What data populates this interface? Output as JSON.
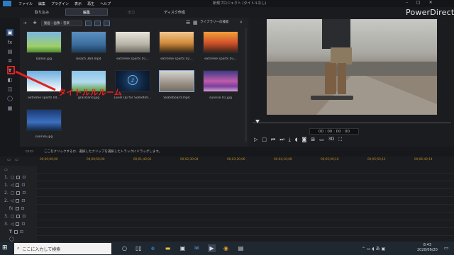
{
  "menu": [
    "ファイル",
    "編集",
    "プラグイン",
    "表示",
    "再生",
    "ヘルプ"
  ],
  "window_title": "新規プロジェクト (タイトルなし)",
  "modes": {
    "import": "取り込み",
    "edit": "編集",
    "produce": "出力",
    "disc": "ディスク作成"
  },
  "brand": "PowerDirector",
  "library": {
    "filter": "動画・画像・音楽",
    "search_label": "ライブラリーの検索",
    "items": [
      {
        "caption": "ballon.jpg",
        "kind": "image"
      },
      {
        "caption": "beach 360.mp4",
        "kind": "video360"
      },
      {
        "caption": "extreme sports 01...",
        "kind": "video"
      },
      {
        "caption": "extreme sports 02...",
        "kind": "video"
      },
      {
        "caption": "extreme sports 03...",
        "kind": "video"
      },
      {
        "caption": "extreme sports 04...",
        "kind": "video"
      },
      {
        "caption": "grassland.jpg",
        "kind": "image"
      },
      {
        "caption": "Level Up for Sometim...",
        "kind": "audio"
      },
      {
        "caption": "Skateboard.mp4",
        "kind": "video",
        "selected": true
      },
      {
        "caption": "sunrise 01.jpg",
        "kind": "image"
      },
      {
        "caption": "sunrise.jpg",
        "kind": "image"
      }
    ]
  },
  "preview": {
    "timecode": "00 : 00 : 00 : 00",
    "mode": "3D"
  },
  "timeline": {
    "hint": "ここをクリックするか、選択したクリップを選択したトラックにドラッグします。",
    "ruler": [
      "00;00;00;00",
      "00;00;50;00",
      "00;01;40;02",
      "00;02;30;04",
      "00;03;20;06",
      "00;04;10;08",
      "00;05;00;10",
      "00;05;50;12",
      "00;06;40;14"
    ]
  },
  "taskbar": {
    "search_placeholder": "ここに入力して検索",
    "time": "8:43",
    "date": "2020/06/20"
  },
  "annotation": "タイトルルルーム"
}
